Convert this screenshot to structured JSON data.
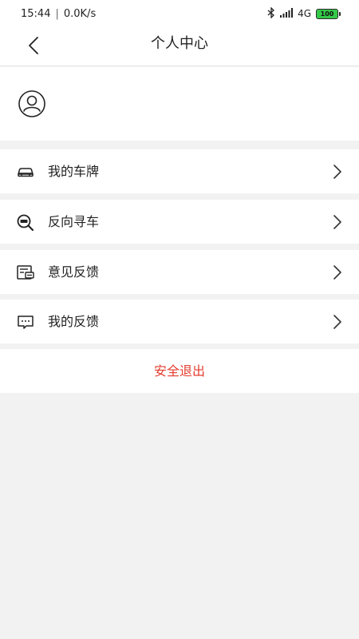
{
  "status_bar": {
    "time": "15:44",
    "separator": "|",
    "net_speed": "0.0K/s",
    "network": "4G",
    "battery": "100"
  },
  "header": {
    "title": "个人中心"
  },
  "menu": {
    "items": [
      {
        "label": "我的车牌",
        "icon": "car-icon"
      },
      {
        "label": "反向寻车",
        "icon": "search-car-icon"
      },
      {
        "label": "意见反馈",
        "icon": "feedback-form-icon"
      },
      {
        "label": "我的反馈",
        "icon": "message-icon"
      }
    ]
  },
  "logout": {
    "label": "安全退出"
  },
  "colors": {
    "background": "#f2f2f2",
    "accent_red": "#e33c2e",
    "battery_green": "#35c94a"
  }
}
